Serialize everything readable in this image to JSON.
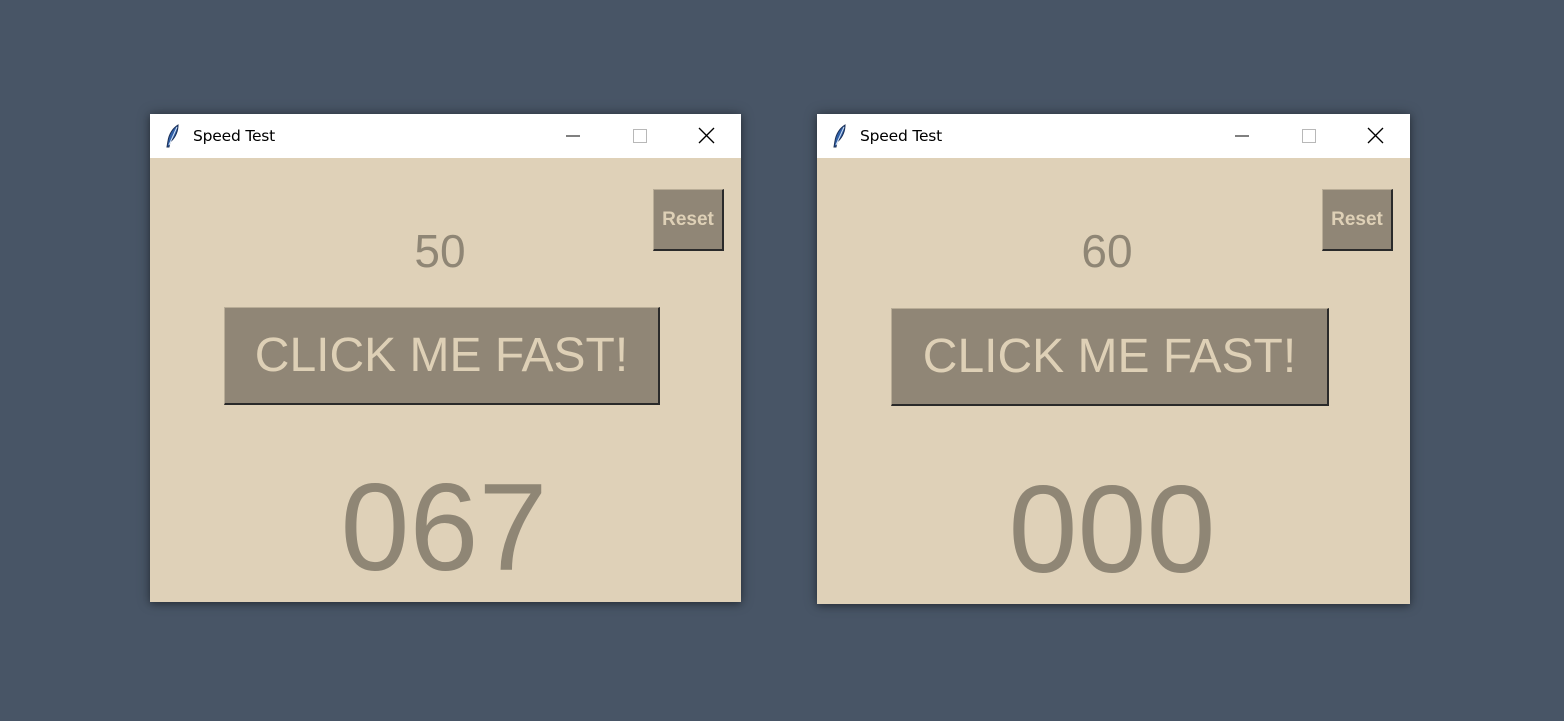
{
  "windows": [
    {
      "title": "Speed Test",
      "reset_label": "Reset",
      "limit": "50",
      "click_label": "CLICK ME FAST!",
      "count": "067"
    },
    {
      "title": "Speed Test",
      "reset_label": "Reset",
      "limit": "60",
      "click_label": "CLICK ME FAST!",
      "count": "000"
    }
  ],
  "icons": {
    "app": "feather-icon",
    "minimize": "minimize-icon",
    "maximize": "maximize-icon",
    "close": "close-icon"
  },
  "colors": {
    "desktop": "#485566",
    "window_bg": "#dfd1b8",
    "button_bg": "#908676",
    "button_text": "#ded0b6",
    "label_text": "#8f8675"
  }
}
